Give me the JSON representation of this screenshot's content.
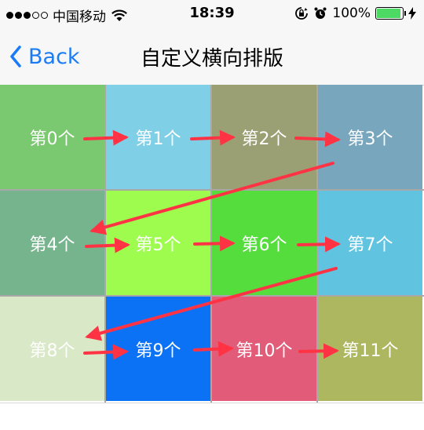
{
  "status_bar": {
    "carrier": "中国移动",
    "time": "18:39",
    "battery": "100%",
    "signal_dots_filled": 3,
    "signal_dots_total": 5
  },
  "nav": {
    "back_label": "Back",
    "title": "自定义横向排版"
  },
  "colors": {
    "accent": "#1a7cf5",
    "arrow": "#ff3344",
    "battery": "#4cd964"
  },
  "cells": [
    {
      "label": "第0个",
      "color": "#7ac86f"
    },
    {
      "label": "第1个",
      "color": "#7fd0e7"
    },
    {
      "label": "第2个",
      "color": "#9aa074"
    },
    {
      "label": "第3个",
      "color": "#78a6bd"
    },
    {
      "label": "第4个",
      "color": "#76b48e"
    },
    {
      "label": "第5个",
      "color": "#9dfc4e"
    },
    {
      "label": "第6个",
      "color": "#55dd3e"
    },
    {
      "label": "第7个",
      "color": "#60c3df"
    },
    {
      "label": "第8个",
      "color": "#d9e8c6"
    },
    {
      "label": "第9个",
      "color": "#0b72f5"
    },
    {
      "label": "第10个",
      "color": "#e25b78"
    },
    {
      "label": "第11个",
      "color": "#adb75f"
    }
  ]
}
